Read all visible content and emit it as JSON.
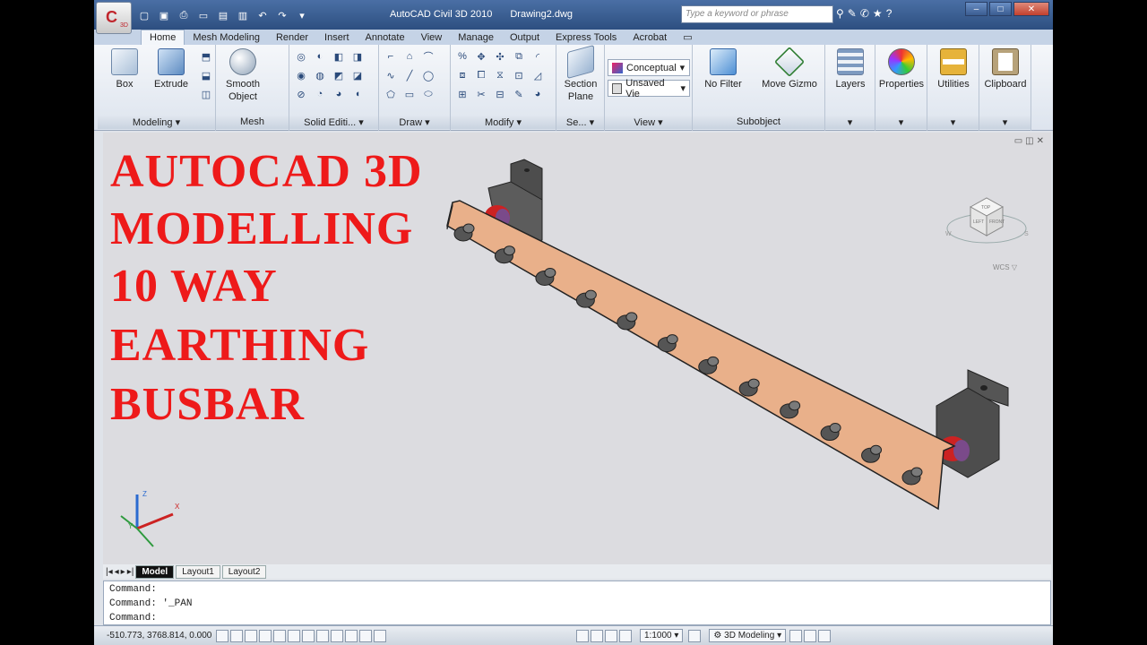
{
  "app": {
    "title": "AutoCAD Civil 3D 2010",
    "document": "Drawing2.dwg",
    "logo_letter": "C",
    "logo_sub": "3D"
  },
  "search": {
    "placeholder": "Type a keyword or phrase"
  },
  "tabs": [
    "Home",
    "Mesh Modeling",
    "Render",
    "Insert",
    "Annotate",
    "View",
    "Manage",
    "Output",
    "Express Tools",
    "Acrobat"
  ],
  "panels": {
    "modeling": {
      "title": "Modeling",
      "box": "Box",
      "extrude": "Extrude"
    },
    "mesh": {
      "title": "Mesh",
      "smooth": "Smooth",
      "object": "Object"
    },
    "solid": {
      "title": "Solid Editi..."
    },
    "draw": {
      "title": "Draw"
    },
    "modify": {
      "title": "Modify"
    },
    "section": {
      "title": "Se...",
      "label1": "Section",
      "label2": "Plane"
    },
    "view": {
      "title": "View",
      "visual_style": "Conceptual",
      "named_view": "Unsaved Vie"
    },
    "subobject": {
      "title": "Subobject",
      "no_filter": "No Filter",
      "move_gizmo": "Move Gizmo"
    },
    "layers": "Layers",
    "properties": "Properties",
    "utilities": "Utilities",
    "clipboard": "Clipboard"
  },
  "overlay_text": [
    "AUTOCAD 3D",
    "MODELLING",
    "10 WAY",
    "EARTHING",
    "BUSBAR"
  ],
  "viewcube": {
    "top": "TOP",
    "left": "LEFT",
    "front": "FRONT",
    "compass_w": "W",
    "compass_s": "S",
    "wcs": "WCS"
  },
  "ucs": {
    "x": "X",
    "y": "Y",
    "z": "Z"
  },
  "layout_tabs": [
    "Model",
    "Layout1",
    "Layout2"
  ],
  "command_lines": [
    "Command:",
    "Command: '_PAN",
    "Command:"
  ],
  "status": {
    "coords": "-510.773, 3768.814, 0.000",
    "scale": "1:1000",
    "workspace": "3D Modeling"
  },
  "colors": {
    "busbar": "#e9b08a",
    "bolt": "#5a5a5a",
    "bracket": "#4d4d4d",
    "insulator": "#cc2222",
    "title_red": "#ee1a1a"
  }
}
